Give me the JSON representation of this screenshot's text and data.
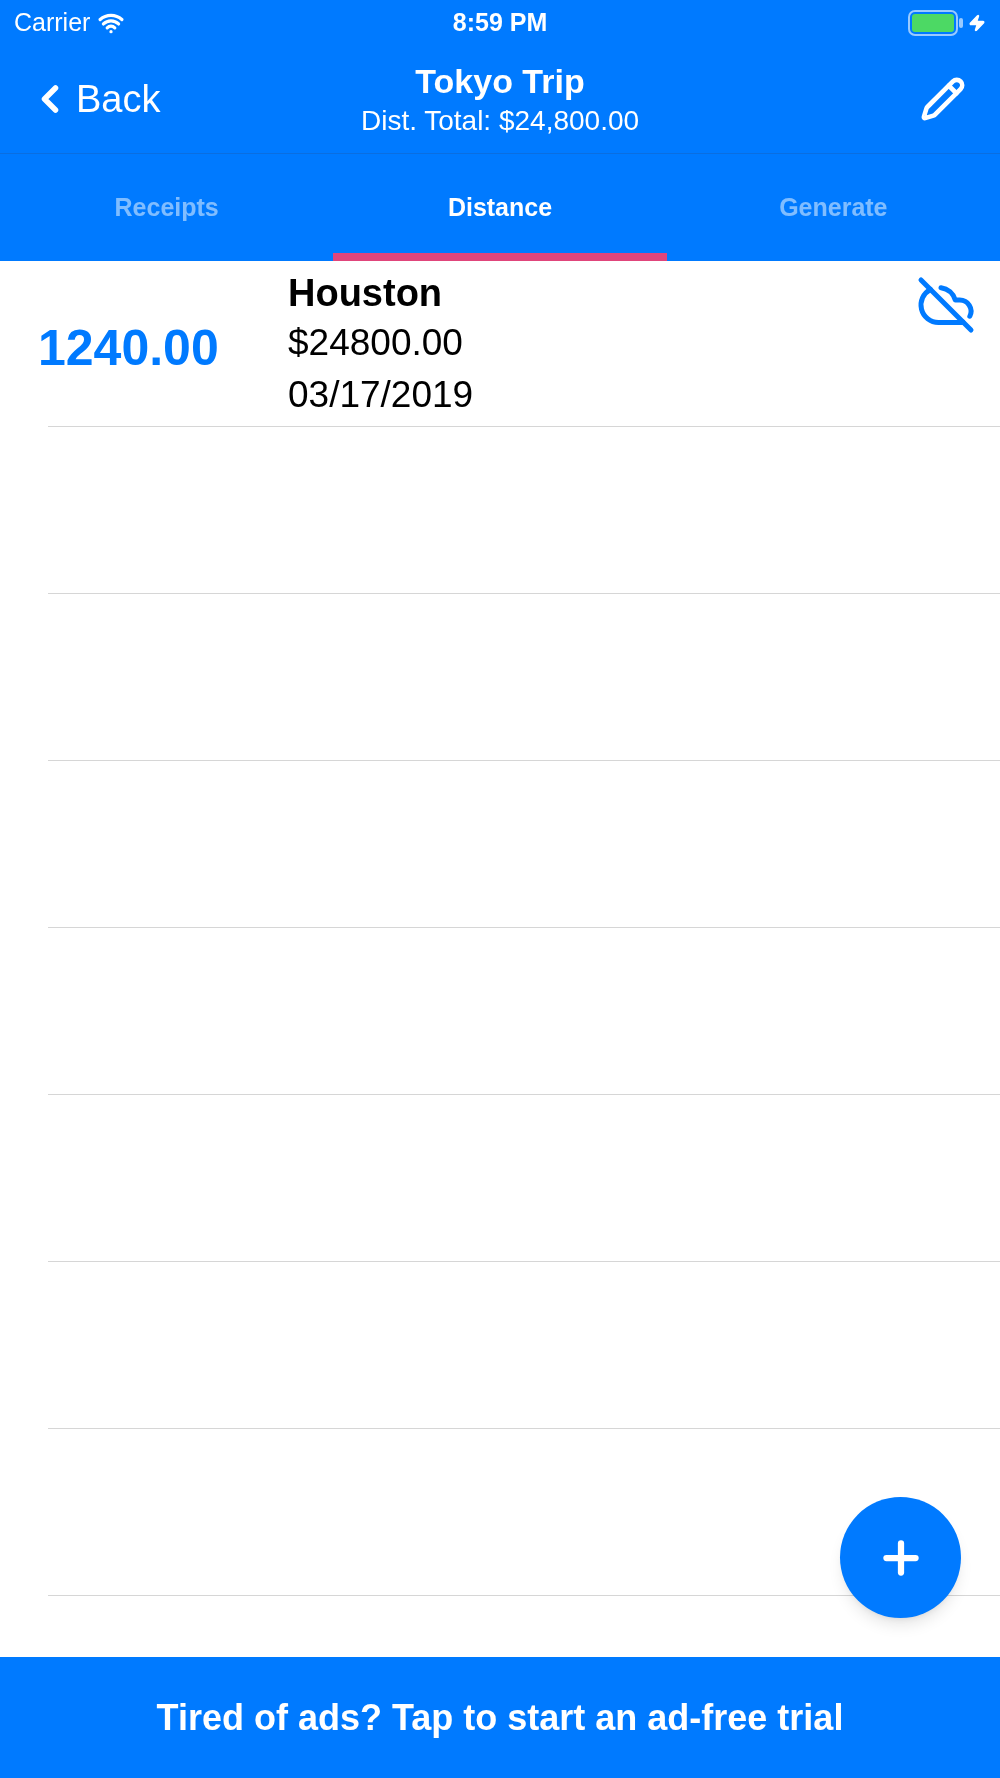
{
  "status_bar": {
    "carrier": "Carrier",
    "time": "8:59 PM"
  },
  "nav_bar": {
    "back": "Back",
    "title": "Tokyo Trip",
    "subtitle": "Dist. Total: $24,800.00"
  },
  "tabs": [
    {
      "label": "Receipts",
      "selected": false
    },
    {
      "label": "Distance",
      "selected": true
    },
    {
      "label": "Generate",
      "selected": false
    }
  ],
  "entries": [
    {
      "distance": "1240.00",
      "location": "Houston",
      "amount": "$24800.00",
      "date": "03/17/2019",
      "synced": false
    }
  ],
  "banner": "Tired of ads? Tap to start an ad-free trial"
}
